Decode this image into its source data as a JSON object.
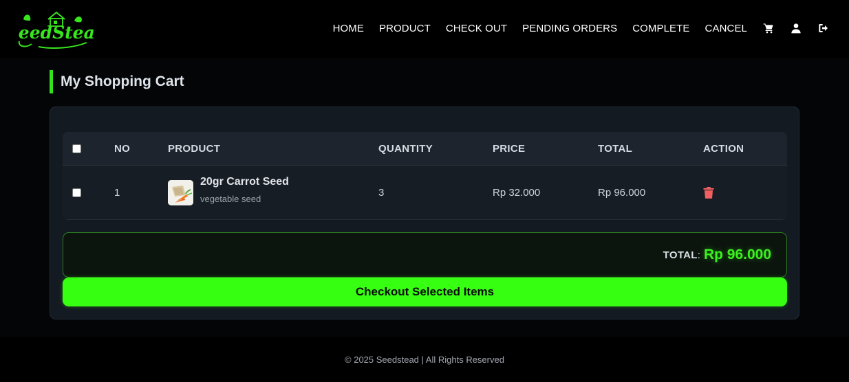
{
  "brand": {
    "logo_text": "SeedStead",
    "accent_color": "#37ff12",
    "logo_icon": "house-leaf-logo"
  },
  "nav": {
    "links": [
      {
        "label": "HOME"
      },
      {
        "label": "PRODUCT"
      },
      {
        "label": "CHECK OUT"
      },
      {
        "label": "PENDING ORDERS"
      },
      {
        "label": "COMPLETE"
      },
      {
        "label": "CANCEL"
      }
    ],
    "icons": [
      "cart-icon",
      "user-icon",
      "logout-icon"
    ]
  },
  "page": {
    "title": "My Shopping Cart"
  },
  "cart": {
    "columns": {
      "no": "NO",
      "product": "PRODUCT",
      "quantity": "QUANTITY",
      "price": "PRICE",
      "total": "TOTAL",
      "action": "ACTION"
    },
    "items": [
      {
        "no": "1",
        "name": "20gr Carrot Seed",
        "category": "vegetable seed",
        "quantity": "3",
        "price": "Rp 32.000",
        "total": "Rp 96.000",
        "action_icon": "trash-icon",
        "checked": false
      }
    ],
    "summary": {
      "label": "TOTAL",
      "colon": ":",
      "value": "Rp 96.000"
    },
    "checkout_label": "Checkout Selected Items",
    "status_colors": {
      "total_value": "#3cf21f",
      "delete": "#f06060"
    }
  },
  "footer": {
    "text": "© 2025 Seedstead | All Rights Reserved"
  }
}
